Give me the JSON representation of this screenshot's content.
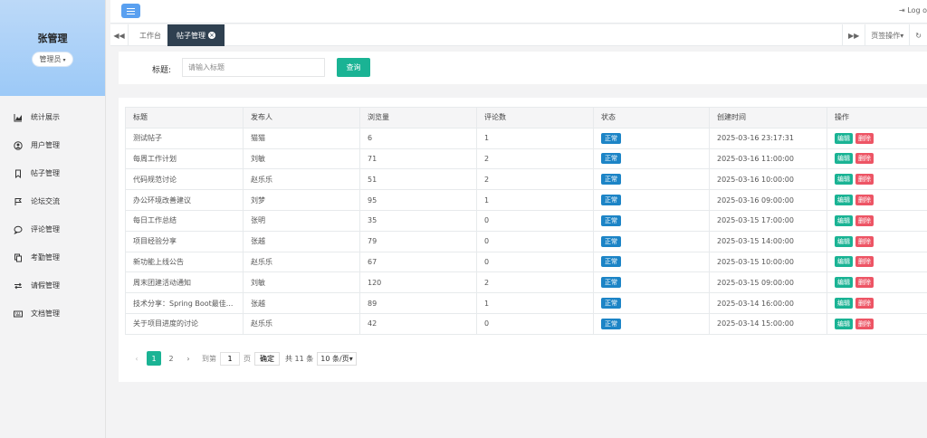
{
  "sidebar": {
    "user_name": "张管理",
    "role": "管理员",
    "items": [
      {
        "label": "统计展示",
        "icon": "chart-area-icon"
      },
      {
        "label": "用户管理",
        "icon": "user-circle-icon"
      },
      {
        "label": "帖子管理",
        "icon": "bookmark-icon"
      },
      {
        "label": "论坛交流",
        "icon": "flag-icon"
      },
      {
        "label": "评论管理",
        "icon": "comment-icon"
      },
      {
        "label": "考勤管理",
        "icon": "copy-icon"
      },
      {
        "label": "请假管理",
        "icon": "exchange-icon"
      },
      {
        "label": "文档管理",
        "icon": "keyboard-icon"
      }
    ]
  },
  "header": {
    "logout_label": "Log o"
  },
  "tabs": {
    "items": [
      {
        "label": "工作台",
        "active": false
      },
      {
        "label": "帖子管理",
        "active": true
      }
    ],
    "page_ops": "页签操作"
  },
  "search": {
    "label": "标题:",
    "placeholder": "请输入标题",
    "button": "查询"
  },
  "table": {
    "columns": [
      "标题",
      "发布人",
      "浏览量",
      "评论数",
      "状态",
      "创建时间",
      "操作"
    ],
    "rows": [
      {
        "title": "测试帖子",
        "author": "猫猫",
        "views": "6",
        "comments": "1",
        "status": "正常",
        "created": "2025-03-16 23:17:31"
      },
      {
        "title": "每周工作计划",
        "author": "刘敏",
        "views": "71",
        "comments": "2",
        "status": "正常",
        "created": "2025-03-16 11:00:00"
      },
      {
        "title": "代码规范讨论",
        "author": "赵乐乐",
        "views": "51",
        "comments": "2",
        "status": "正常",
        "created": "2025-03-16 10:00:00"
      },
      {
        "title": "办公环境改善建议",
        "author": "刘梦",
        "views": "95",
        "comments": "1",
        "status": "正常",
        "created": "2025-03-16 09:00:00"
      },
      {
        "title": "每日工作总结",
        "author": "张明",
        "views": "35",
        "comments": "0",
        "status": "正常",
        "created": "2025-03-15 17:00:00"
      },
      {
        "title": "项目经验分享",
        "author": "张越",
        "views": "79",
        "comments": "0",
        "status": "正常",
        "created": "2025-03-15 14:00:00"
      },
      {
        "title": "新功能上线公告",
        "author": "赵乐乐",
        "views": "67",
        "comments": "0",
        "status": "正常",
        "created": "2025-03-15 10:00:00"
      },
      {
        "title": "周末团建活动通知",
        "author": "刘敏",
        "views": "120",
        "comments": "2",
        "status": "正常",
        "created": "2025-03-15 09:00:00"
      },
      {
        "title": "技术分享：Spring Boot最佳...",
        "author": "张越",
        "views": "89",
        "comments": "1",
        "status": "正常",
        "created": "2025-03-14 16:00:00"
      },
      {
        "title": "关于项目进度的讨论",
        "author": "赵乐乐",
        "views": "42",
        "comments": "0",
        "status": "正常",
        "created": "2025-03-14 15:00:00"
      }
    ],
    "edit_label": "编辑",
    "delete_label": "删除"
  },
  "pager": {
    "prev": "‹",
    "pages": [
      "1",
      "2"
    ],
    "next": "›",
    "goto_label": "到第",
    "goto_value": "1",
    "page_unit": "页",
    "confirm": "确定",
    "total": "共 11 条",
    "page_size": "10 条/页"
  },
  "colors": {
    "primary": "#1ab394",
    "info": "#1c84c6",
    "danger": "#ed5565",
    "tab_active": "#2f4050",
    "hamburger": "#5aa0f0"
  }
}
